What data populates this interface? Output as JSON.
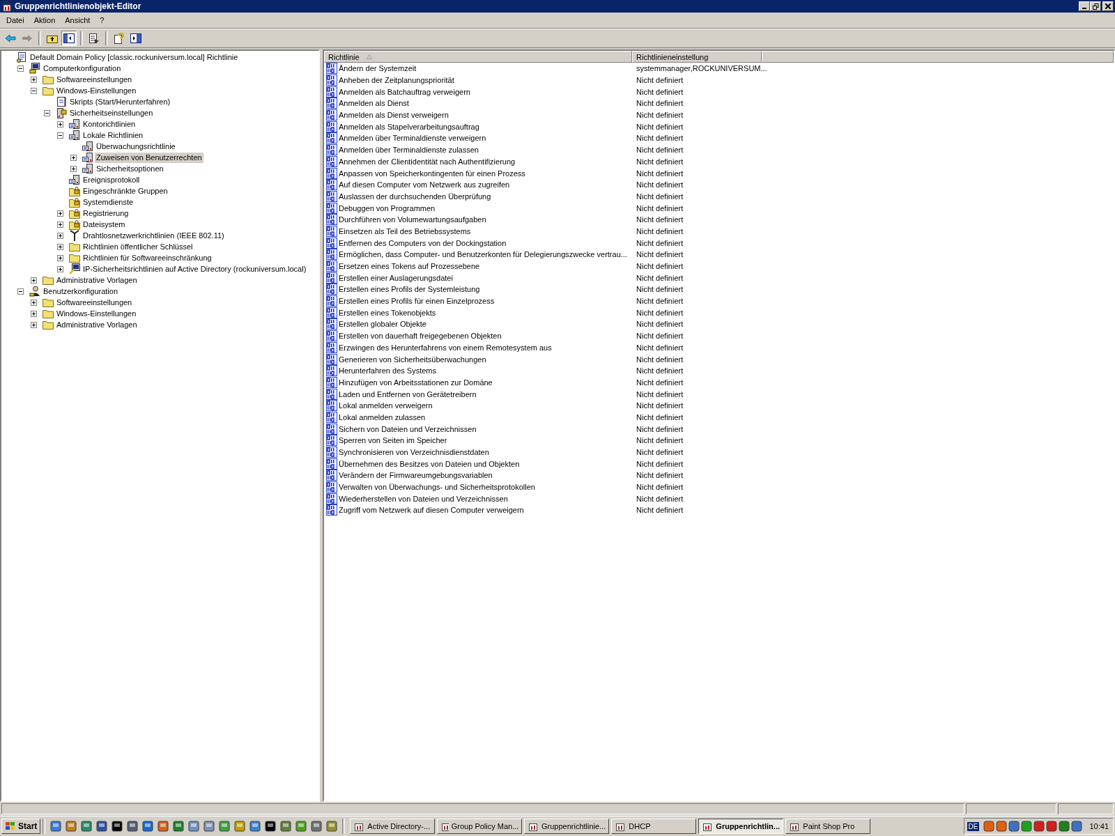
{
  "window": {
    "title": "Gruppenrichtlinienobjekt-Editor"
  },
  "menu": [
    "Datei",
    "Aktion",
    "Ansicht",
    "?"
  ],
  "toolbar": [
    [
      {
        "kind": "back",
        "pressed": false
      },
      {
        "kind": "forward",
        "pressed": false
      }
    ],
    [
      {
        "kind": "up",
        "pressed": false
      },
      {
        "kind": "tree",
        "pressed": true
      }
    ],
    [
      {
        "kind": "export",
        "pressed": false
      }
    ],
    [
      {
        "kind": "help",
        "pressed": false
      },
      {
        "kind": "pane",
        "pressed": false
      }
    ]
  ],
  "tree": [
    {
      "label": "Default Domain Policy [classic.rockuniversum.local] Richtlinie",
      "kind": "policy",
      "selected": false,
      "children": [
        {
          "label": "Computerkonfiguration",
          "kind": "computer",
          "expanded": true,
          "selected": false,
          "children": [
            {
              "label": "Softwareeinstellungen",
              "kind": "folder",
              "expanded": false,
              "selected": false
            },
            {
              "label": "Windows-Einstellungen",
              "kind": "folder",
              "expanded": true,
              "selected": false,
              "children": [
                {
                  "label": "Skripts (Start/Herunterfahren)",
                  "kind": "script",
                  "selected": false
                },
                {
                  "label": "Sicherheitseinstellungen",
                  "kind": "security",
                  "expanded": true,
                  "selected": false,
                  "children": [
                    {
                      "label": "Kontorichtlinien",
                      "kind": "settings",
                      "expanded": false,
                      "selected": false
                    },
                    {
                      "label": "Lokale Richtlinien",
                      "kind": "settings",
                      "expanded": true,
                      "selected": false,
                      "children": [
                        {
                          "label": "Überwachungsrichtlinie",
                          "kind": "settings",
                          "selected": false
                        },
                        {
                          "label": "Zuweisen von Benutzerrechten",
                          "kind": "settings",
                          "expanded": false,
                          "selected": true
                        },
                        {
                          "label": "Sicherheitsoptionen",
                          "kind": "settings",
                          "expanded": false,
                          "selected": false
                        }
                      ]
                    },
                    {
                      "label": "Ereignisprotokoll",
                      "kind": "settings",
                      "selected": false
                    },
                    {
                      "label": "Eingeschränkte Gruppen",
                      "kind": "lockfolder",
                      "selected": false
                    },
                    {
                      "label": "Systemdienste",
                      "kind": "lockfolder",
                      "selected": false
                    },
                    {
                      "label": "Registrierung",
                      "kind": "lockfolder",
                      "expanded": false,
                      "selected": false
                    },
                    {
                      "label": "Dateisystem",
                      "kind": "lockfolder",
                      "expanded": false,
                      "selected": false
                    },
                    {
                      "label": "Drahtlosnetzwerkrichtlinien (IEEE 802.11)",
                      "kind": "antenna",
                      "expanded": false,
                      "selected": false
                    },
                    {
                      "label": "Richtlinien öffentlicher Schlüssel",
                      "kind": "folder",
                      "expanded": false,
                      "selected": false
                    },
                    {
                      "label": "Richtlinien für Softwareeinschränkung",
                      "kind": "folder",
                      "expanded": false,
                      "selected": false
                    },
                    {
                      "label": "IP-Sicherheitsrichtlinien auf Active Directory (rockuniversum.local)",
                      "kind": "ipsec",
                      "expanded": false,
                      "selected": false
                    }
                  ]
                }
              ]
            },
            {
              "label": "Administrative Vorlagen",
              "kind": "folder",
              "expanded": false,
              "selected": false
            }
          ]
        },
        {
          "label": "Benutzerkonfiguration",
          "kind": "user",
          "expanded": true,
          "selected": false,
          "children": [
            {
              "label": "Softwareeinstellungen",
              "kind": "folder",
              "expanded": false,
              "selected": false
            },
            {
              "label": "Windows-Einstellungen",
              "kind": "folder",
              "expanded": false,
              "selected": false
            },
            {
              "label": "Administrative Vorlagen",
              "kind": "folder",
              "expanded": false,
              "selected": false
            }
          ]
        }
      ]
    }
  ],
  "table": {
    "columns": [
      "Richtlinie",
      "Richtlinieneinstellung"
    ],
    "rows": [
      [
        "Ändern der Systemzeit",
        "systemmanager,ROCKUNIVERSUM..."
      ],
      [
        "Anheben der Zeitplanungspriorität",
        "Nicht definiert"
      ],
      [
        "Anmelden als Batchauftrag verweigern",
        "Nicht definiert"
      ],
      [
        "Anmelden als Dienst",
        "Nicht definiert"
      ],
      [
        "Anmelden als Dienst verweigern",
        "Nicht definiert"
      ],
      [
        "Anmelden als Stapelverarbeitungsauftrag",
        "Nicht definiert"
      ],
      [
        "Anmelden über Terminaldienste verweigern",
        "Nicht definiert"
      ],
      [
        "Anmelden über Terminaldienste zulassen",
        "Nicht definiert"
      ],
      [
        "Annehmen der Clientidentität nach Authentifizierung",
        "Nicht definiert"
      ],
      [
        "Anpassen von Speicherkontingenten für einen Prozess",
        "Nicht definiert"
      ],
      [
        "Auf diesen Computer vom Netzwerk aus zugreifen",
        "Nicht definiert"
      ],
      [
        "Auslassen der durchsuchenden Überprüfung",
        "Nicht definiert"
      ],
      [
        "Debuggen von Programmen",
        "Nicht definiert"
      ],
      [
        "Durchführen von Volumewartungsaufgaben",
        "Nicht definiert"
      ],
      [
        "Einsetzen als Teil des Betriebssystems",
        "Nicht definiert"
      ],
      [
        "Entfernen des Computers von der Dockingstation",
        "Nicht definiert"
      ],
      [
        "Ermöglichen, dass Computer- und Benutzerkonten für Delegierungszwecke vertrau...",
        "Nicht definiert"
      ],
      [
        "Ersetzen eines Tokens auf Prozessebene",
        "Nicht definiert"
      ],
      [
        "Erstellen einer Auslagerungsdatei",
        "Nicht definiert"
      ],
      [
        "Erstellen eines Profils der Systemleistung",
        "Nicht definiert"
      ],
      [
        "Erstellen eines Profils für einen Einzelprozess",
        "Nicht definiert"
      ],
      [
        "Erstellen eines Tokenobjekts",
        "Nicht definiert"
      ],
      [
        "Erstellen globaler Objekte",
        "Nicht definiert"
      ],
      [
        "Erstellen von dauerhaft freigegebenen Objekten",
        "Nicht definiert"
      ],
      [
        "Erzwingen des Herunterfahrens von einem Remotesystem aus",
        "Nicht definiert"
      ],
      [
        "Generieren von Sicherheitsüberwachungen",
        "Nicht definiert"
      ],
      [
        "Herunterfahren des Systems",
        "Nicht definiert"
      ],
      [
        "Hinzufügen von Arbeitsstationen zur Domäne",
        "Nicht definiert"
      ],
      [
        "Laden und Entfernen von Gerätetreibern",
        "Nicht definiert"
      ],
      [
        "Lokal anmelden verweigern",
        "Nicht definiert"
      ],
      [
        "Lokal anmelden zulassen",
        "Nicht definiert"
      ],
      [
        "Sichern von Dateien und Verzeichnissen",
        "Nicht definiert"
      ],
      [
        "Sperren von Seiten im Speicher",
        "Nicht definiert"
      ],
      [
        "Synchronisieren von Verzeichnisdienstdaten",
        "Nicht definiert"
      ],
      [
        "Übernehmen des Besitzes von Dateien und Objekten",
        "Nicht definiert"
      ],
      [
        "Verändern der Firmwareumgebungsvariablen",
        "Nicht definiert"
      ],
      [
        "Verwalten von Überwachungs- und Sicherheitsprotokollen",
        "Nicht definiert"
      ],
      [
        "Wiederherstellen von Dateien und Verzeichnissen",
        "Nicht definiert"
      ],
      [
        "Zugriff vom Netzwerk auf diesen Computer verweigern",
        "Nicht definiert"
      ]
    ]
  },
  "taskbar": {
    "start": "Start",
    "tasks": [
      {
        "label": "Active Directory-...",
        "selected": false
      },
      {
        "label": "Group Policy Man...",
        "selected": false
      },
      {
        "label": "Gruppenrichtlinie...",
        "selected": false
      },
      {
        "label": "DHCP",
        "selected": false
      },
      {
        "label": "Gruppenrichtlin...",
        "selected": true
      },
      {
        "label": "Paint Shop Pro",
        "selected": false
      }
    ],
    "language": "DE",
    "clock": "10:41"
  }
}
